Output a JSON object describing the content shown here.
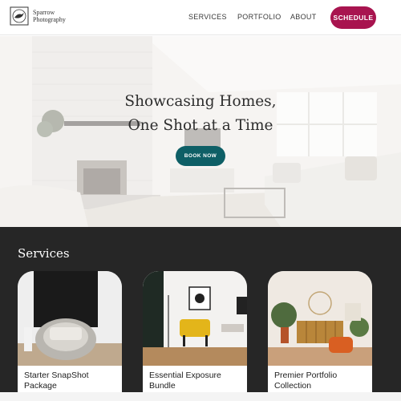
{
  "brand": {
    "name": "Sparrow Photography"
  },
  "nav": {
    "items": [
      {
        "label": "SERVICES"
      },
      {
        "label": "PORTFOLIO"
      },
      {
        "label": "ABOUT"
      }
    ],
    "cta": "SCHEDULE"
  },
  "hero": {
    "title_line1": "Showcasing Homes,",
    "title_line2": "One Shot at a Time",
    "button": "BOOK NOW"
  },
  "services": {
    "title": "Services",
    "cards": [
      {
        "title": "Starter SnapShot Package"
      },
      {
        "title": "Essential Exposure Bundle"
      },
      {
        "title": "Premier Portfolio Collection"
      }
    ]
  },
  "colors": {
    "accent": "#a8144f",
    "button_teal": "#0e5f66",
    "services_bg": "#262626"
  }
}
